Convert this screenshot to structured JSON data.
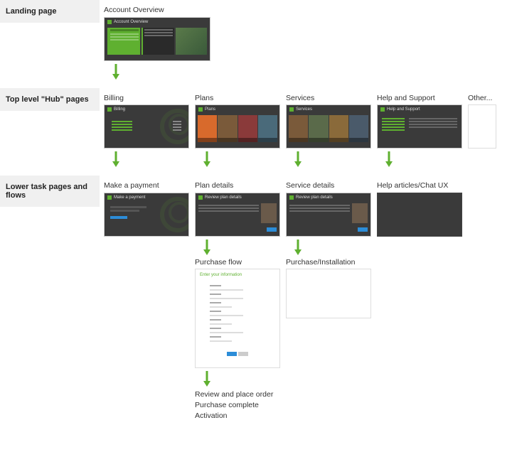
{
  "rows": {
    "landing": {
      "label": "Landing page"
    },
    "hub": {
      "label": "Top level \"Hub\" pages"
    },
    "lower": {
      "label": "Lower task pages and flows"
    }
  },
  "landing": {
    "title": "Account Overview",
    "thumb_title": "Account Overview"
  },
  "hub": {
    "billing": {
      "title": "Billing",
      "thumb_title": "Billing"
    },
    "plans": {
      "title": "Plans",
      "thumb_title": "Plans"
    },
    "services": {
      "title": "Services",
      "thumb_title": "Services"
    },
    "help": {
      "title": "Help and Support",
      "thumb_title": "Help and Support"
    },
    "other": {
      "title": "Other..."
    }
  },
  "lower": {
    "payment": {
      "title": "Make a payment",
      "thumb_title": "Make a payment"
    },
    "plan_details": {
      "title": "Plan details",
      "thumb_title": "Review plan details"
    },
    "service_details": {
      "title": "Service details",
      "thumb_title": "Review plan details"
    },
    "help_articles": {
      "title": "Help articles/Chat UX"
    },
    "purchase_flow": {
      "title": "Purchase flow",
      "thumb_title": "Enter your information"
    },
    "purchase_install": {
      "title": "Purchase/Installation"
    },
    "review": {
      "line1": "Review and place order",
      "line2": "Purchase complete",
      "line3": "Activation"
    }
  }
}
